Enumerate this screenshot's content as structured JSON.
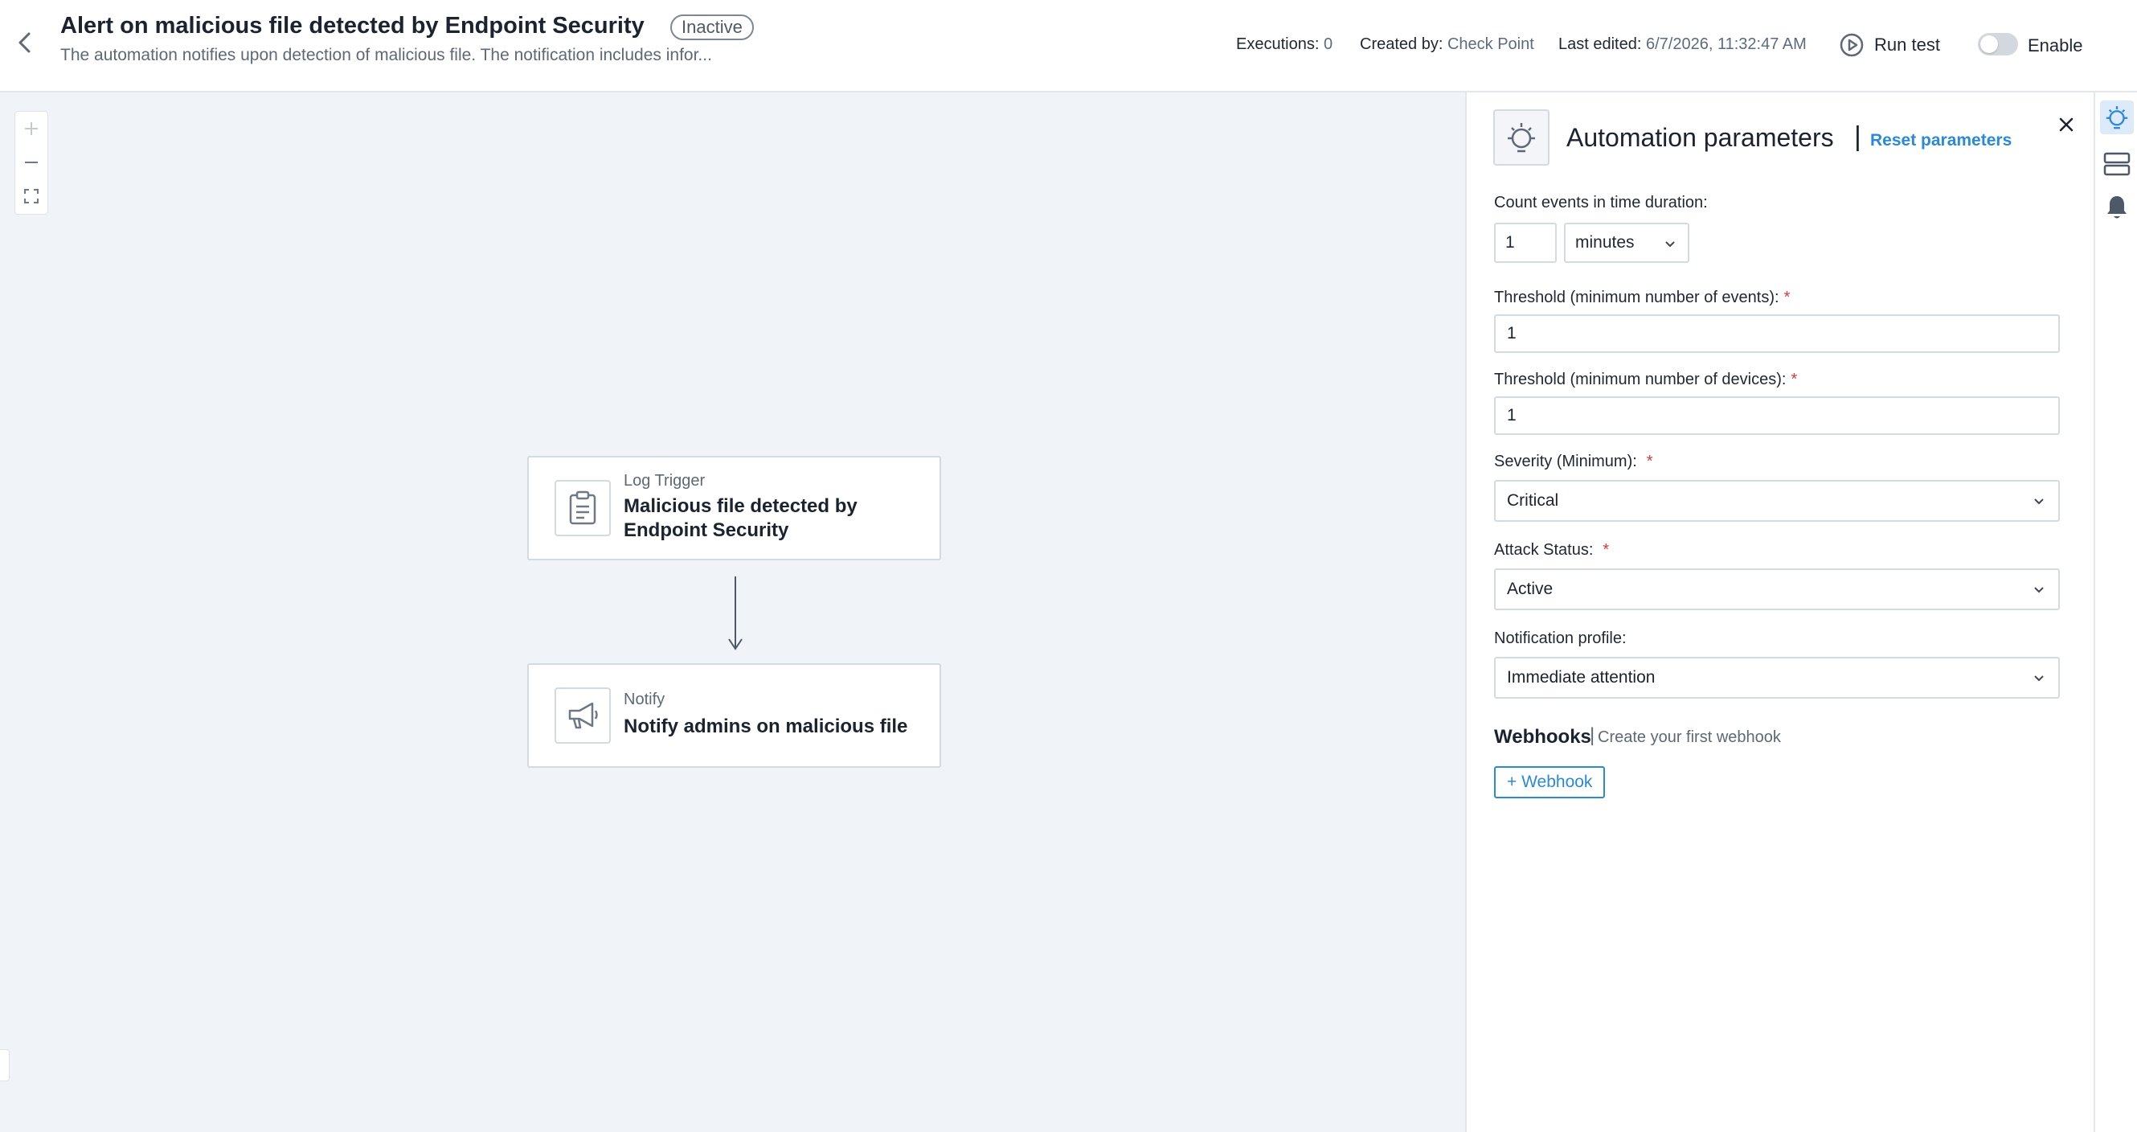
{
  "header": {
    "title": "Alert on malicious file detected by Endpoint Security",
    "status": "Inactive",
    "subtitle": "The automation notifies upon detection of malicious file. The notification includes infor...",
    "executions_label": "Executions:",
    "executions_value": "0",
    "created_by_label": "Created by:",
    "created_by_value": "Check Point",
    "last_edited_label": "Last edited:",
    "last_edited_value": "6/7/2026, 11:32:47 AM",
    "run_test_label": "Run test",
    "enable_label": "Enable",
    "enabled": false
  },
  "canvas": {
    "zoom_controls": [
      "+",
      "—",
      "fit"
    ],
    "nodes": [
      {
        "type": "Log Trigger",
        "name": "Malicious file detected by Endpoint Security",
        "icon": "clipboard-icon"
      },
      {
        "type": "Notify",
        "name": "Notify admins on malicious file",
        "icon": "megaphone-icon"
      }
    ]
  },
  "panel": {
    "title": "Automation parameters",
    "title_separator": "|",
    "reset_label": "Reset parameters",
    "count_events_label": "Count events in time duration:",
    "count_value": "1",
    "count_unit": "minutes",
    "threshold_events_label": "Threshold (minimum number of events):",
    "threshold_events_value": "1",
    "threshold_devices_label": "Threshold (minimum number of devices):",
    "threshold_devices_value": "1",
    "severity_label": "Severity (Minimum):",
    "severity_value": "Critical",
    "attack_status_label": "Attack Status:",
    "attack_status_value": "Active",
    "notification_profile_label": "Notification profile:",
    "notification_profile_value": "Immediate attention",
    "required_mark": "*",
    "webhooks_title": "Webhooks",
    "webhooks_separator": "|",
    "webhooks_hint": "Create your first webhook",
    "add_webhook_label": "+ Webhook"
  },
  "colors": {
    "accent": "#2a8ad8",
    "canvas_bg": "#f0f3f7",
    "required": "#d93a3a",
    "active_rail": "#dceafa"
  }
}
